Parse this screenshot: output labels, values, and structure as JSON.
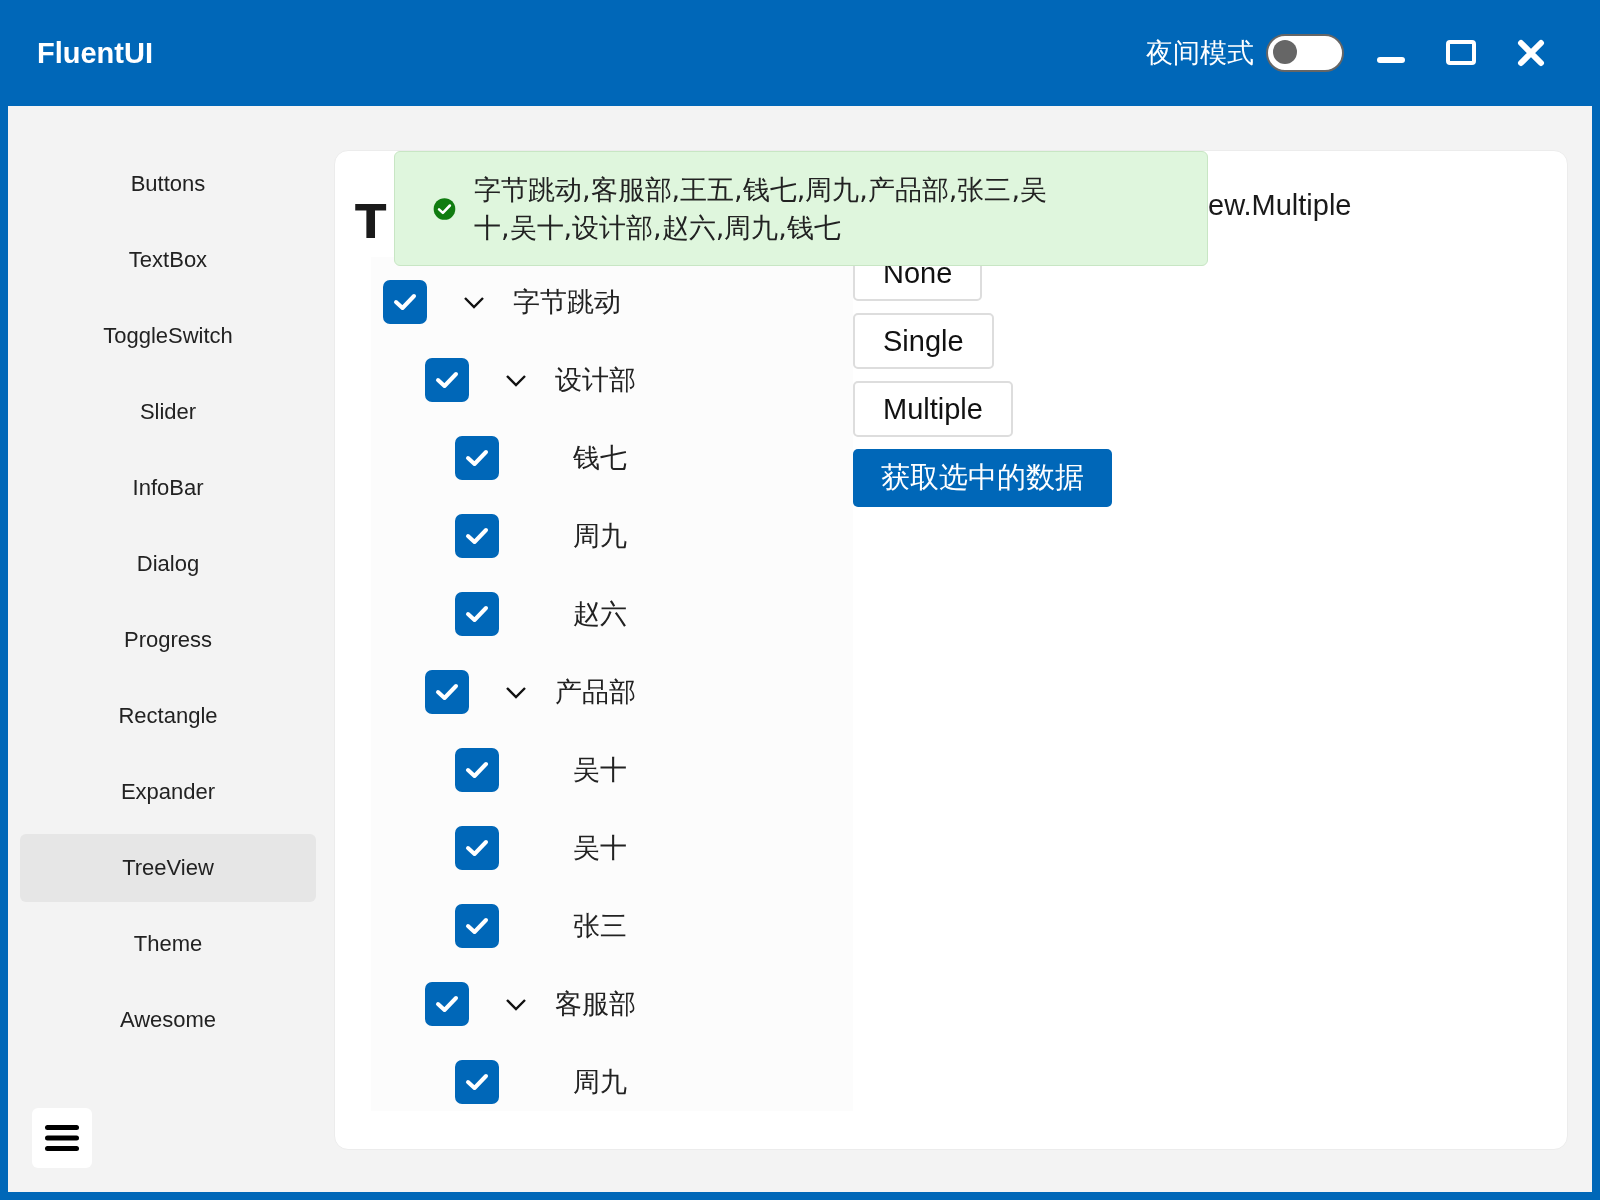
{
  "window": {
    "title": "FluentUI"
  },
  "night_mode": {
    "label": "夜间模式",
    "on": false
  },
  "sidebar": {
    "items": [
      {
        "label": "Buttons",
        "selected": false
      },
      {
        "label": "TextBox",
        "selected": false
      },
      {
        "label": "ToggleSwitch",
        "selected": false
      },
      {
        "label": "Slider",
        "selected": false
      },
      {
        "label": "InfoBar",
        "selected": false
      },
      {
        "label": "Dialog",
        "selected": false
      },
      {
        "label": "Progress",
        "selected": false
      },
      {
        "label": "Rectangle",
        "selected": false
      },
      {
        "label": "Expander",
        "selected": false
      },
      {
        "label": "TreeView",
        "selected": true
      },
      {
        "label": "Theme",
        "selected": false
      },
      {
        "label": "Awesome",
        "selected": false
      }
    ]
  },
  "page": {
    "heading": "T",
    "mode_caption": "ew.Multiple",
    "buttons": [
      {
        "label": "None",
        "kind": "plain"
      },
      {
        "label": "Single",
        "kind": "plain"
      },
      {
        "label": "Multiple",
        "kind": "plain"
      },
      {
        "label": "获取选中的数据",
        "kind": "primary"
      }
    ],
    "tree": [
      {
        "label": "字节跳动",
        "checked": true,
        "expanded": true,
        "children": [
          {
            "label": "设计部",
            "checked": true,
            "expanded": true,
            "children": [
              {
                "label": "钱七",
                "checked": true
              },
              {
                "label": "周九",
                "checked": true
              },
              {
                "label": "赵六",
                "checked": true
              }
            ]
          },
          {
            "label": "产品部",
            "checked": true,
            "expanded": true,
            "children": [
              {
                "label": "吴十",
                "checked": true
              },
              {
                "label": "吴十",
                "checked": true
              },
              {
                "label": "张三",
                "checked": true
              }
            ]
          },
          {
            "label": "客服部",
            "checked": true,
            "expanded": true,
            "children": [
              {
                "label": "周九",
                "checked": true
              }
            ]
          }
        ]
      }
    ],
    "infobar": {
      "kind": "success",
      "message": "字节跳动,客服部,王五,钱七,周九,产品部,张三,吴十,吴十,设计部,赵六,周九,钱七"
    }
  }
}
